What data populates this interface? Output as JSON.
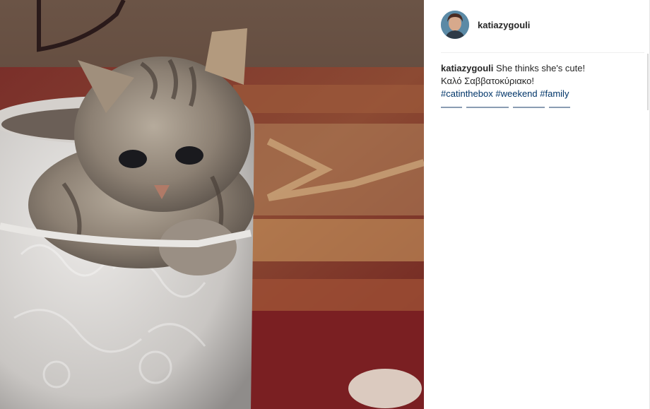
{
  "post": {
    "image_alt": "Tabby kitten sitting in a white embossed pot on a red patterned rug",
    "author": {
      "username": "katiazygouli",
      "avatar_icon": "profile-avatar"
    },
    "caption": {
      "username": "katiazygouli",
      "line1": "She thinks she's cute!",
      "line2": "Καλό Σαββατοκύριακο!",
      "hashtags": [
        "#catinthebox",
        "#weekend",
        "#family"
      ]
    }
  },
  "colors": {
    "text": "#262626",
    "hashtag": "#003569",
    "divider": "#efefef"
  }
}
